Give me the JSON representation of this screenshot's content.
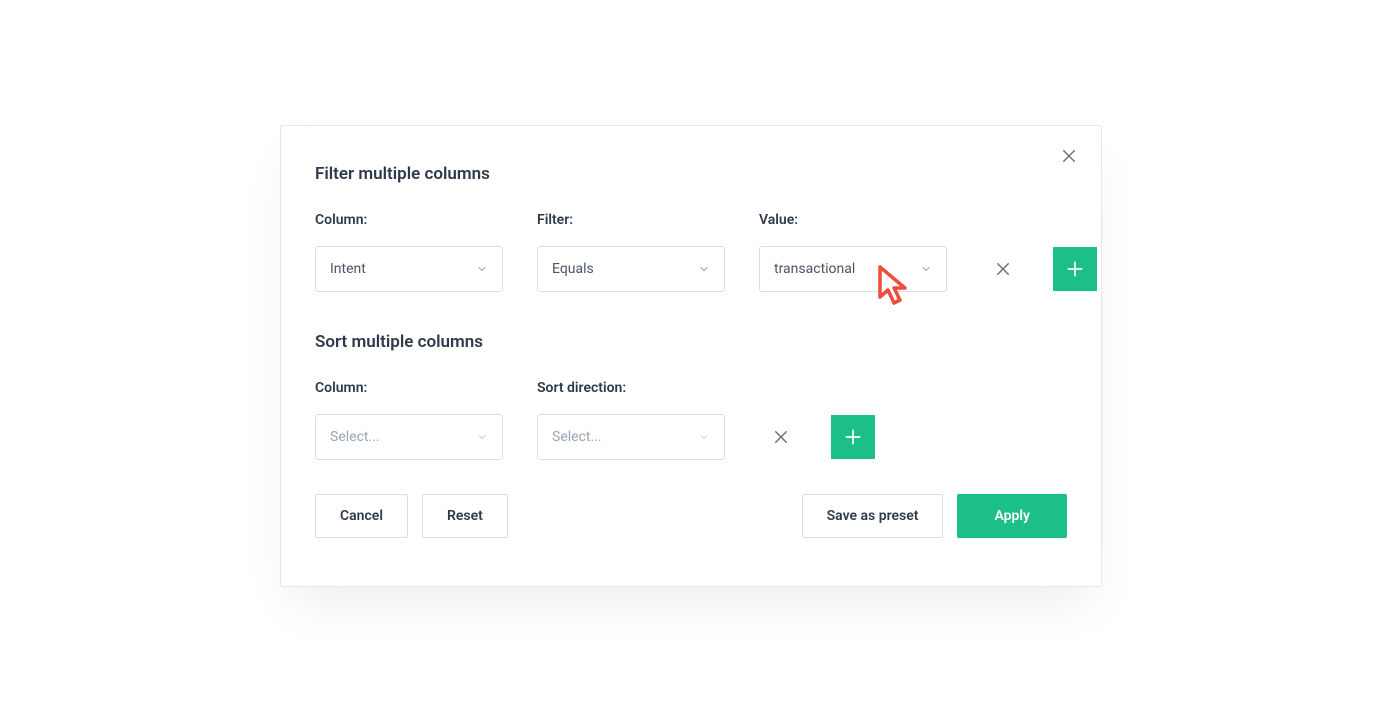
{
  "modal": {
    "filter_heading": "Filter multiple columns",
    "sort_heading": "Sort multiple columns",
    "labels": {
      "column": "Column:",
      "filter": "Filter:",
      "value": "Value:",
      "sort_direction": "Sort direction:"
    },
    "filter_row": {
      "column_value": "Intent",
      "filter_value": "Equals",
      "value_value": "transactional"
    },
    "sort_row": {
      "column_placeholder": "Select...",
      "direction_placeholder": "Select..."
    },
    "buttons": {
      "cancel": "Cancel",
      "reset": "Reset",
      "save_preset": "Save as preset",
      "apply": "Apply"
    }
  }
}
